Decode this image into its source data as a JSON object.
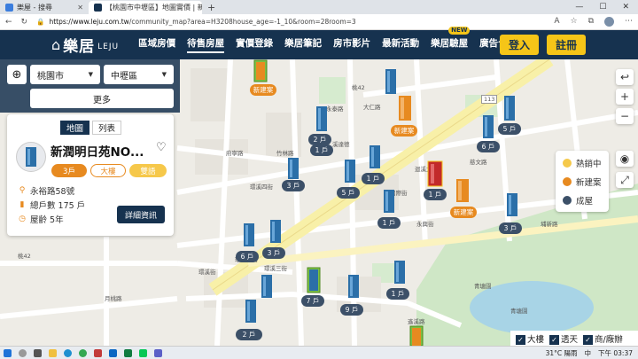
{
  "browser": {
    "tabs": [
      {
        "label": "樂屋 - 搜尋"
      },
      {
        "label": "【桃園市中壢區】地圖實價 | 新"
      }
    ],
    "new_tab": "+",
    "url_host": "https://www.leju.com.tw",
    "url_path": "/community_map?area=H3208house_age=-1_10&room=28room=3"
  },
  "header": {
    "logo_cn": "樂居",
    "logo_en": "LEJU",
    "nav": [
      "區域房價",
      "待售房屋",
      "實價登錄",
      "樂居筆記",
      "房市影片",
      "最新活動",
      "樂居驗屋",
      "廣告合作"
    ],
    "new_badge": "NEW",
    "login": "登入",
    "register": "註冊"
  },
  "filters": {
    "city": "桃園市",
    "district": "中壢區",
    "more": "更多"
  },
  "view_tabs": [
    "地圖",
    "列表"
  ],
  "card": {
    "title": "新潤明日苑NO...",
    "chips": [
      "3戶",
      "大樓",
      "雙語"
    ],
    "address": "永裕路58號",
    "total_units": "總戶數 175 戶",
    "age": "屋齡 5年",
    "detail_button": "詳細資訊"
  },
  "markers": [
    {
      "label": "新建案",
      "type": "new"
    },
    {
      "label": "2 戶",
      "type": "sold"
    },
    {
      "label": "1 戶",
      "type": "sold"
    },
    {
      "label": "新建案",
      "type": "new"
    },
    {
      "label": "5 戶",
      "type": "sold"
    },
    {
      "label": "6 戶",
      "type": "sold"
    },
    {
      "label": "3 戶",
      "type": "sold"
    },
    {
      "label": "5 戶",
      "type": "sold"
    },
    {
      "label": "1 戶",
      "type": "sold"
    },
    {
      "label": "1 戶",
      "type": "hot"
    },
    {
      "label": "新建案",
      "type": "new"
    },
    {
      "label": "1 戶",
      "type": "sold"
    },
    {
      "label": "3 戶",
      "type": "sold"
    },
    {
      "label": "6 戶",
      "type": "sold"
    },
    {
      "label": "3 戶",
      "type": "sold"
    },
    {
      "label": "7 戶",
      "type": "selected"
    },
    {
      "label": "9 戶",
      "type": "sold"
    },
    {
      "label": "1 戶",
      "type": "sold"
    },
    {
      "label": "2 戶",
      "type": "sold"
    }
  ],
  "legend": [
    {
      "label": "熱銷中",
      "color": "#f5c94a"
    },
    {
      "label": "新建案",
      "color": "#e78a20"
    },
    {
      "label": "成屋",
      "color": "#3c5068"
    }
  ],
  "bottom_filter": [
    "大樓",
    "透天",
    "商/廠辦"
  ],
  "road_labels": [
    "桃42",
    "永泰路",
    "大仁路",
    "府寧路",
    "竹林路",
    "環溪四街",
    "環溪一街",
    "環溪三街",
    "環溪街",
    "月桃路",
    "迴溪大街",
    "桃42",
    "慈文路",
    "永興街",
    "遙溪路",
    "青塘園",
    "青塘園",
    "埔新路",
    "溪達德",
    "國際街",
    "113"
  ],
  "taskbar": {
    "weather": "31°C 陽雨",
    "lang": "中",
    "time": "下午 03:37"
  },
  "colors": {
    "header_bg": "#16324f",
    "accent_yellow": "#f5c518",
    "orange": "#e78a20",
    "sold_pill": "#3c5068",
    "road_main": "#f8f0a8",
    "park": "#cfe7c6"
  }
}
